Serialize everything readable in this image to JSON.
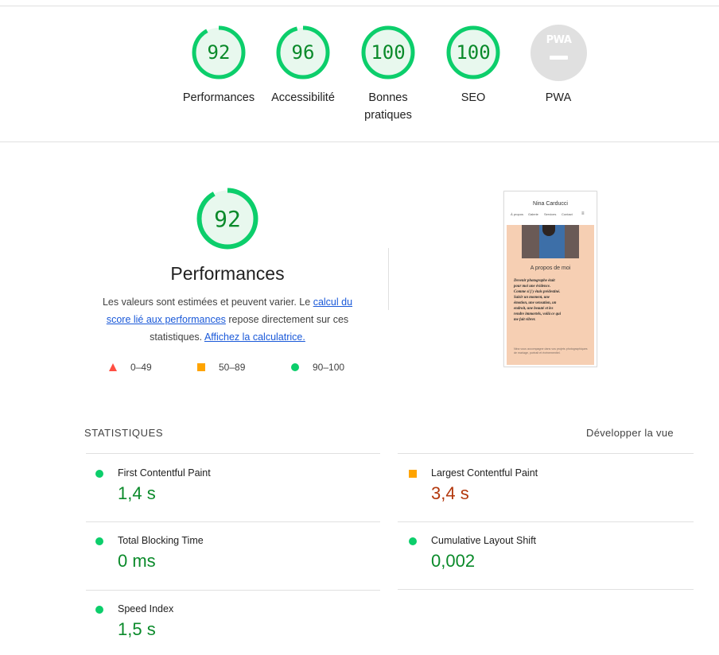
{
  "scores": [
    {
      "key": "performance",
      "value": "92",
      "label": "Performances",
      "fraction": 0.92
    },
    {
      "key": "accessibility",
      "value": "96",
      "label": "Accessibilité",
      "fraction": 0.96
    },
    {
      "key": "best-practices",
      "value": "100",
      "label": "Bonnes\npratiques",
      "fraction": 1.0
    },
    {
      "key": "seo",
      "value": "100",
      "label": "SEO",
      "fraction": 1.0
    }
  ],
  "pwa": {
    "badge": "PWA",
    "label": "PWA"
  },
  "performance_section": {
    "score": "92",
    "fraction": 0.92,
    "title": "Performances",
    "desc_part1": "Les valeurs sont estimées et peuvent varier. Le ",
    "desc_link1": "calcul du score lié aux performances",
    "desc_part2": " repose directement sur ces statistiques. ",
    "desc_link2": "Affichez la calculatrice.",
    "legend": [
      {
        "range": "0–49",
        "shape": "triangle",
        "color": "#ff4e42"
      },
      {
        "range": "50–89",
        "shape": "square",
        "color": "#ffa400"
      },
      {
        "range": "90–100",
        "shape": "circle",
        "color": "#0cce6b"
      }
    ]
  },
  "screenshot": {
    "brand": "Nina Carducci",
    "nav": [
      "À propos",
      "Galerie",
      "Services",
      "Contact"
    ],
    "menu_icon": "≡",
    "heading": "A propos de moi",
    "quote": "Devenir photographe était pour moi une évidence. Comme si j'y étais prédestiné. Saisir un moment, une émotion, une sensation, un endroit, une beauté et les rendre immortels, voilà ce qui me fait vibrer.",
    "small_text": "Nina vous accompagne dans vos projets photographiques de mariage, portrait et événementiel."
  },
  "statistics": {
    "heading": "STATISTIQUES",
    "expand_label": "Développer la vue",
    "metrics": [
      {
        "name": "First Contentful Paint",
        "value": "1,4 s",
        "rating": "good"
      },
      {
        "name": "Largest Contentful Paint",
        "value": "3,4 s",
        "rating": "average"
      },
      {
        "name": "Total Blocking Time",
        "value": "0 ms",
        "rating": "good"
      },
      {
        "name": "Cumulative Layout Shift",
        "value": "0,002",
        "rating": "good"
      },
      {
        "name": "Speed Index",
        "value": "1,5 s",
        "rating": "good"
      }
    ]
  },
  "colors": {
    "pass": "#0cce6b",
    "pass_text": "#0a8a2a",
    "average": "#ffa400",
    "average_text": "#b3380d",
    "fail": "#ff4e42",
    "link": "#1a59d9"
  }
}
